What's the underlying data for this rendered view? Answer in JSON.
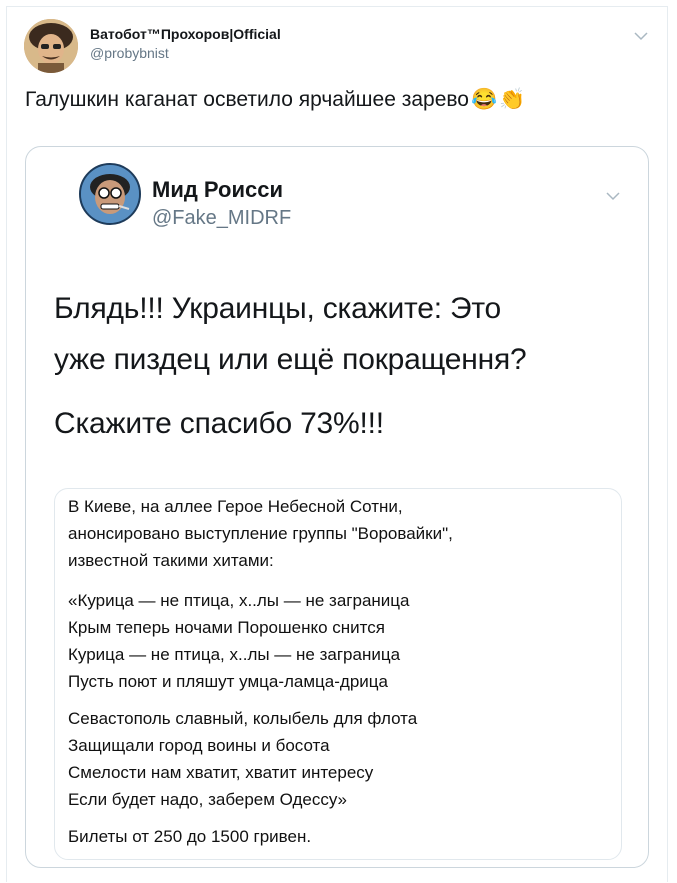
{
  "tweet": {
    "author_name": "Ватобот™Прохоров|Official",
    "author_handle": "@probybnist",
    "text": "Галушкин каганат осветило ярчайшее зарево",
    "emojis": [
      "😂",
      "👏"
    ]
  },
  "quoted": {
    "author_name": "Мид Роисси",
    "author_handle": "@Fake_MIDRF",
    "lines": [
      "Блядь!!! Украинцы, скажите: Это",
      "уже пиздец или ещё покращення?",
      "Скажите спасибо 73%!!!"
    ],
    "image_text": [
      "В Киеве, на аллее Герое Небесной Сотни,",
      "анонсировано выступление группы \"Воровайки\",",
      "известной такими хитами:",
      "«Курица — не птица, х..лы — не заграница",
      "Крым теперь ночами Порошенко снится",
      "Курица — не птица, х..лы — не заграница",
      "Пусть поют и пляшут умца-ламца-дрица",
      "Севастополь славный, колыбель для флота",
      "Защищали город воины и босота",
      "Смелости нам хватит, хватит интересу",
      "Если будет надо, заберем Одессу»",
      "Билеты от 250 до 1500 гривен."
    ]
  },
  "icons": {
    "menu": "chevron-down-icon",
    "emoji_1": "face-with-tears-of-joy-icon",
    "emoji_2": "clapping-hands-icon"
  },
  "colors": {
    "text": "#14171a",
    "muted": "#657786",
    "border": "#ccd6dd"
  }
}
